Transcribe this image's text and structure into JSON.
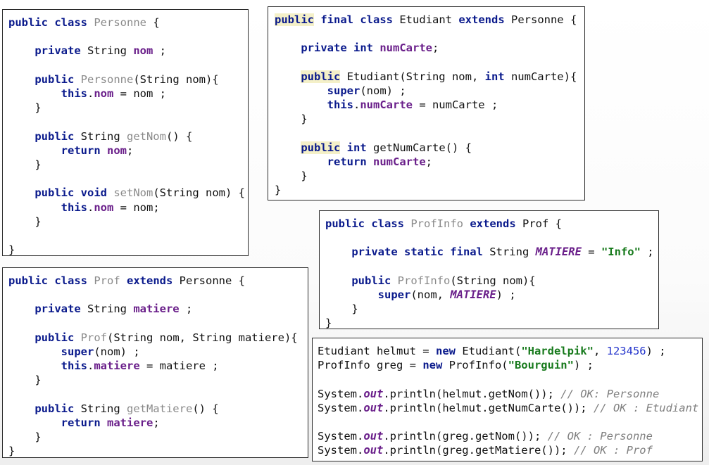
{
  "code_blocks": {
    "personne": [
      [
        {
          "t": "public class",
          "s": "k"
        },
        {
          "t": " "
        },
        {
          "t": "Personne",
          "s": "c"
        },
        {
          "t": " {"
        }
      ],
      [],
      [
        {
          "t": "    "
        },
        {
          "t": "private",
          "s": "k"
        },
        {
          "t": " String "
        },
        {
          "t": "nom",
          "s": "f"
        },
        {
          "t": " ;"
        }
      ],
      [],
      [
        {
          "t": "    "
        },
        {
          "t": "public",
          "s": "k"
        },
        {
          "t": " "
        },
        {
          "t": "Personne",
          "s": "c"
        },
        {
          "t": "(String nom){"
        }
      ],
      [
        {
          "t": "        "
        },
        {
          "t": "this",
          "s": "k"
        },
        {
          "t": "."
        },
        {
          "t": "nom",
          "s": "f"
        },
        {
          "t": " = nom ;"
        }
      ],
      [
        {
          "t": "    }"
        }
      ],
      [],
      [
        {
          "t": "    "
        },
        {
          "t": "public",
          "s": "k"
        },
        {
          "t": " String "
        },
        {
          "t": "getNom",
          "s": "c"
        },
        {
          "t": "() {"
        }
      ],
      [
        {
          "t": "        "
        },
        {
          "t": "return",
          "s": "k"
        },
        {
          "t": " "
        },
        {
          "t": "nom",
          "s": "f"
        },
        {
          "t": ";"
        }
      ],
      [
        {
          "t": "    }"
        }
      ],
      [],
      [
        {
          "t": "    "
        },
        {
          "t": "public void",
          "s": "k"
        },
        {
          "t": " "
        },
        {
          "t": "setNom",
          "s": "c"
        },
        {
          "t": "(String nom) {"
        }
      ],
      [
        {
          "t": "        "
        },
        {
          "t": "this",
          "s": "k"
        },
        {
          "t": "."
        },
        {
          "t": "nom",
          "s": "f"
        },
        {
          "t": " = nom;"
        }
      ],
      [
        {
          "t": "    }"
        }
      ],
      [],
      [
        {
          "t": "}"
        }
      ]
    ],
    "etudiant": [
      [
        {
          "t": "public",
          "s": "k hl"
        },
        {
          "t": " "
        },
        {
          "t": "final class",
          "s": "k"
        },
        {
          "t": " Etudiant "
        },
        {
          "t": "extends",
          "s": "k"
        },
        {
          "t": " Personne {"
        }
      ],
      [],
      [
        {
          "t": "    "
        },
        {
          "t": "private int",
          "s": "k"
        },
        {
          "t": " "
        },
        {
          "t": "numCarte",
          "s": "f"
        },
        {
          "t": ";"
        }
      ],
      [],
      [
        {
          "t": "    "
        },
        {
          "t": "public",
          "s": "k hl"
        },
        {
          "t": " Etudiant(String nom, "
        },
        {
          "t": "int",
          "s": "k"
        },
        {
          "t": " numCarte){"
        }
      ],
      [
        {
          "t": "        "
        },
        {
          "t": "super",
          "s": "k"
        },
        {
          "t": "(nom) ;"
        }
      ],
      [
        {
          "t": "        "
        },
        {
          "t": "this",
          "s": "k"
        },
        {
          "t": "."
        },
        {
          "t": "numCarte",
          "s": "f"
        },
        {
          "t": " = numCarte ;"
        }
      ],
      [
        {
          "t": "    }"
        }
      ],
      [],
      [
        {
          "t": "    "
        },
        {
          "t": "public",
          "s": "k hl"
        },
        {
          "t": " "
        },
        {
          "t": "int",
          "s": "k"
        },
        {
          "t": " getNumCarte() {"
        }
      ],
      [
        {
          "t": "        "
        },
        {
          "t": "return",
          "s": "k"
        },
        {
          "t": " "
        },
        {
          "t": "numCarte",
          "s": "f"
        },
        {
          "t": ";"
        }
      ],
      [
        {
          "t": "    }"
        }
      ],
      [
        {
          "t": "}"
        }
      ]
    ],
    "profinfo": [
      [
        {
          "t": "public class",
          "s": "k"
        },
        {
          "t": " "
        },
        {
          "t": "ProfInfo",
          "s": "c"
        },
        {
          "t": " "
        },
        {
          "t": "extends",
          "s": "k"
        },
        {
          "t": " Prof {"
        }
      ],
      [],
      [
        {
          "t": "    "
        },
        {
          "t": "private static final",
          "s": "k"
        },
        {
          "t": " String "
        },
        {
          "t": "MATIERE",
          "s": "st"
        },
        {
          "t": " = "
        },
        {
          "t": "\"Info\"",
          "s": "s"
        },
        {
          "t": " ;"
        }
      ],
      [],
      [
        {
          "t": "    "
        },
        {
          "t": "public",
          "s": "k"
        },
        {
          "t": " "
        },
        {
          "t": "ProfInfo",
          "s": "c"
        },
        {
          "t": "(String nom){"
        }
      ],
      [
        {
          "t": "        "
        },
        {
          "t": "super",
          "s": "k"
        },
        {
          "t": "(nom, "
        },
        {
          "t": "MATIERE",
          "s": "st"
        },
        {
          "t": ") ;"
        }
      ],
      [
        {
          "t": "    }"
        }
      ],
      [
        {
          "t": "}"
        }
      ]
    ],
    "prof": [
      [
        {
          "t": "public class",
          "s": "k"
        },
        {
          "t": " "
        },
        {
          "t": "Prof",
          "s": "c"
        },
        {
          "t": " "
        },
        {
          "t": "extends",
          "s": "k"
        },
        {
          "t": " Personne {"
        }
      ],
      [],
      [
        {
          "t": "    "
        },
        {
          "t": "private",
          "s": "k"
        },
        {
          "t": " String "
        },
        {
          "t": "matiere",
          "s": "f"
        },
        {
          "t": " ;"
        }
      ],
      [],
      [
        {
          "t": "    "
        },
        {
          "t": "public",
          "s": "k"
        },
        {
          "t": " "
        },
        {
          "t": "Prof",
          "s": "c"
        },
        {
          "t": "(String nom, String matiere){"
        }
      ],
      [
        {
          "t": "        "
        },
        {
          "t": "super",
          "s": "k"
        },
        {
          "t": "(nom) ;"
        }
      ],
      [
        {
          "t": "        "
        },
        {
          "t": "this",
          "s": "k"
        },
        {
          "t": "."
        },
        {
          "t": "matiere",
          "s": "f"
        },
        {
          "t": " = matiere ;"
        }
      ],
      [
        {
          "t": "    }"
        }
      ],
      [],
      [
        {
          "t": "    "
        },
        {
          "t": "public",
          "s": "k"
        },
        {
          "t": " String "
        },
        {
          "t": "getMatiere",
          "s": "c"
        },
        {
          "t": "() {"
        }
      ],
      [
        {
          "t": "        "
        },
        {
          "t": "return",
          "s": "k"
        },
        {
          "t": " "
        },
        {
          "t": "matiere",
          "s": "f"
        },
        {
          "t": ";"
        }
      ],
      [
        {
          "t": "    }"
        }
      ],
      [
        {
          "t": "}"
        }
      ]
    ],
    "main": [
      [
        {
          "t": "Etudiant helmut = "
        },
        {
          "t": "new",
          "s": "k"
        },
        {
          "t": " Etudiant("
        },
        {
          "t": "\"Hardelpik\"",
          "s": "s"
        },
        {
          "t": ", "
        },
        {
          "t": "123456",
          "s": "n"
        },
        {
          "t": ") ;"
        }
      ],
      [
        {
          "t": "ProfInfo greg = "
        },
        {
          "t": "new",
          "s": "k"
        },
        {
          "t": " ProfInfo("
        },
        {
          "t": "\"Bourguin\"",
          "s": "s"
        },
        {
          "t": ") ;"
        }
      ],
      [],
      [
        {
          "t": "System."
        },
        {
          "t": "out",
          "s": "st"
        },
        {
          "t": ".println(helmut.getNom()); "
        },
        {
          "t": "// OK: Personne",
          "s": "cm"
        }
      ],
      [
        {
          "t": "System."
        },
        {
          "t": "out",
          "s": "st"
        },
        {
          "t": ".println(helmut.getNumCarte()); "
        },
        {
          "t": "// OK : Etudiant",
          "s": "cm"
        }
      ],
      [],
      [
        {
          "t": "System."
        },
        {
          "t": "out",
          "s": "st"
        },
        {
          "t": ".println(greg.getNom()); "
        },
        {
          "t": "// OK : Personne",
          "s": "cm"
        }
      ],
      [
        {
          "t": "System."
        },
        {
          "t": "out",
          "s": "st"
        },
        {
          "t": ".println(greg.getMatiere()); "
        },
        {
          "t": "// OK : Prof",
          "s": "cm"
        }
      ]
    ]
  }
}
